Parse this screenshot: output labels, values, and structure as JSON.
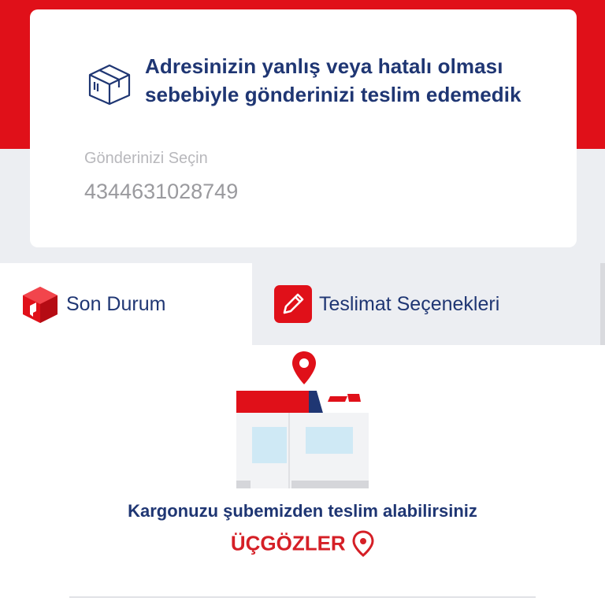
{
  "card": {
    "title": "Adresinizin yanlış veya hatalı olması sebebiyle gönderinizi teslim edemedik",
    "select_label": "Gönderinizi Seçin",
    "select_value": "4344631028749"
  },
  "tabs": [
    {
      "label": "Son Durum",
      "icon": "box-icon",
      "active": true
    },
    {
      "label": "Teslimat Seçenekleri",
      "icon": "pencil-icon",
      "active": false
    }
  ],
  "status": {
    "message": "Kargonuzu şubemizden teslim alabilirsiniz",
    "branch": "ÜÇGÖZLER"
  },
  "colors": {
    "brand_red": "#e01019",
    "navy": "#1f3673",
    "light_grey": "#eceef2"
  }
}
